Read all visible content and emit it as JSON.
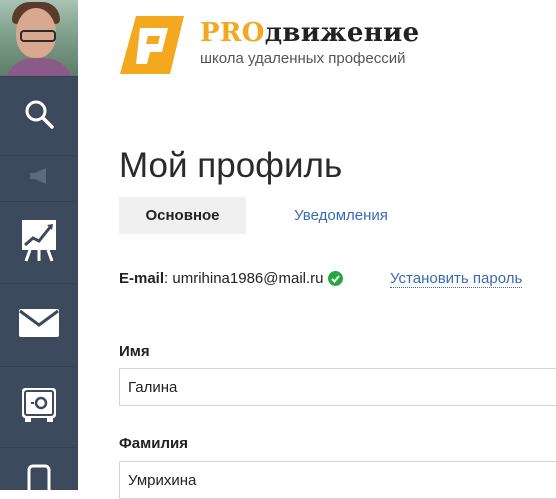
{
  "logo": {
    "title_pro": "PRO",
    "title_rest": "движение",
    "subtitle": "школа удаленных профессий",
    "colors": {
      "accent": "#f4a81d",
      "dark": "#222222"
    }
  },
  "sidebar": {
    "background": "#3d4a5e",
    "items": [
      {
        "icon": "search-icon"
      },
      {
        "icon": "megaphone-icon"
      },
      {
        "icon": "chart-board-icon"
      },
      {
        "icon": "mail-icon"
      },
      {
        "icon": "safe-icon"
      },
      {
        "icon": "phone-icon"
      }
    ]
  },
  "page": {
    "title": "Мой профиль",
    "tabs": [
      {
        "label": "Основное",
        "active": true
      },
      {
        "label": "Уведомления",
        "active": false
      }
    ]
  },
  "email": {
    "label": "E-mail",
    "separator": ":",
    "value": "umrihina1986@mail.ru",
    "verified": true,
    "set_password_link": "Установить пароль"
  },
  "form": {
    "first_name": {
      "label": "Имя",
      "value": "Галина"
    },
    "last_name": {
      "label": "Фамилия",
      "value": "Умрихина"
    }
  }
}
